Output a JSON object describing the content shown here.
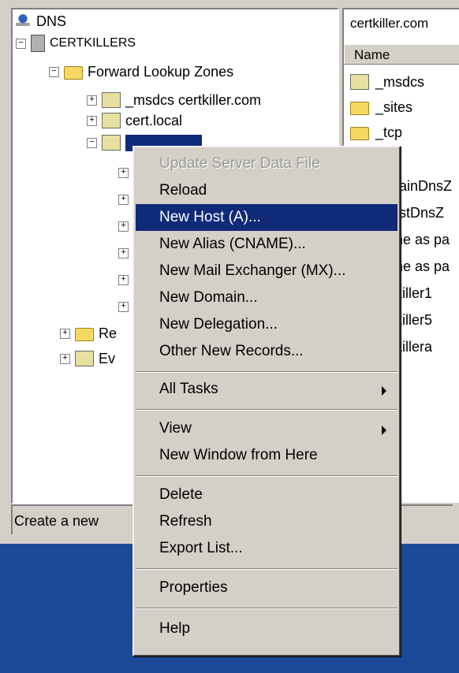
{
  "tree": {
    "root": "DNS",
    "server": "CERTKILLERS",
    "forward_zones": "Forward Lookup Zones",
    "zones": [
      "_msdcs certkiller.com",
      "cert.local"
    ],
    "selected_zone": "",
    "reverse_partial": "Re",
    "event_partial": "Ev"
  },
  "list": {
    "header_title": "certkiller.com",
    "column_name": "Name",
    "items": [
      "_msdcs",
      "_sites",
      "_tcp",
      "p",
      "nainDnsZ",
      "estDnsZ",
      "me as pa",
      "me as pa",
      "tkiller1",
      "tkiller5",
      "tkillera"
    ]
  },
  "status": {
    "text": "Create a new"
  },
  "context_menu": {
    "update": "Update Server Data File",
    "reload": "Reload",
    "new_host": "New Host (A)...",
    "new_alias": "New Alias (CNAME)...",
    "new_mx": "New Mail Exchanger (MX)...",
    "new_domain": "New Domain...",
    "new_delegation": "New Delegation...",
    "other_records": "Other New Records...",
    "all_tasks": "All Tasks",
    "view": "View",
    "new_window": "New Window from Here",
    "delete": "Delete",
    "refresh": "Refresh",
    "export_list": "Export List...",
    "properties": "Properties",
    "help": "Help"
  },
  "colors": {
    "highlight": "#102a7a",
    "desktop": "#1c4a98",
    "chrome": "#d4d0c8"
  },
  "icons": [
    "dns-icon",
    "server-icon",
    "folder-icon",
    "zone-icon",
    "submenu-arrow-icon"
  ]
}
